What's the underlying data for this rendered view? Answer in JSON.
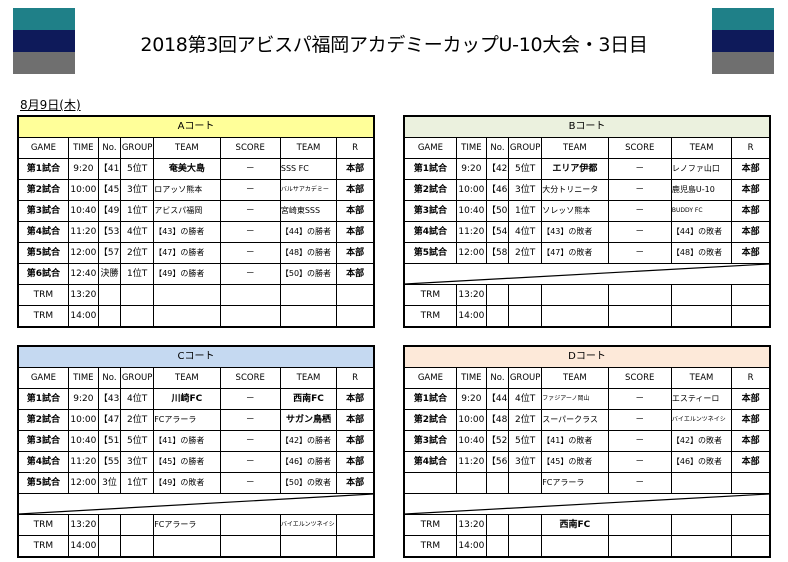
{
  "title": "2018第3回アビスパ福岡アカデミーカップU-10大会・3日目",
  "date": "8月9日(木)",
  "flag_colors": [
    "#1f8088",
    "#0e1a5a",
    "#6f6f6f"
  ],
  "columns": [
    "GAME",
    "TIME",
    "No.",
    "GROUP",
    "TEAM",
    "SCORE",
    "TEAM",
    "R"
  ],
  "courts": [
    {
      "name": "Aコート",
      "color": "#ffff99",
      "rows": [
        [
          "第1試合",
          "9:20",
          "【41】",
          "5位T",
          "奄美大島",
          "－",
          "SSS FC",
          "本部"
        ],
        [
          "第2試合",
          "10:00",
          "【45】",
          "3位T",
          "ロアッソ熊本",
          "－",
          "バルサアカデミー",
          "本部"
        ],
        [
          "第3試合",
          "10:40",
          "【49】",
          "1位T",
          "アビスパ福岡",
          "－",
          "宮崎東SSS",
          "本部"
        ],
        [
          "第4試合",
          "11:20",
          "【53】",
          "4位T",
          "【43】の勝者",
          "－",
          "【44】の勝者",
          "本部"
        ],
        [
          "第5試合",
          "12:00",
          "【57】",
          "2位T",
          "【47】の勝者",
          "－",
          "【48】の勝者",
          "本部"
        ],
        [
          "第6試合",
          "12:40",
          "決勝",
          "1位T",
          "【49】の勝者",
          "－",
          "【50】の勝者",
          "本部"
        ]
      ],
      "trm": [
        [
          "TRM",
          "13:20",
          "",
          "",
          "",
          "",
          "",
          ""
        ],
        [
          "TRM",
          "14:00",
          "",
          "",
          "",
          "",
          "",
          ""
        ]
      ],
      "has_divider": false
    },
    {
      "name": "Bコート",
      "color": "#ebf1de",
      "rows": [
        [
          "第1試合",
          "9:20",
          "【42】",
          "5位T",
          "エリア伊都",
          "－",
          "レノファ山口",
          "本部"
        ],
        [
          "第2試合",
          "10:00",
          "【46】",
          "3位T",
          "大分トリニータ",
          "－",
          "鹿児島U-10",
          "本部"
        ],
        [
          "第3試合",
          "10:40",
          "【50】",
          "1位T",
          "ソレッソ熊本",
          "－",
          "BUDDY FC",
          "本部"
        ],
        [
          "第4試合",
          "11:20",
          "【54】",
          "4位T",
          "【43】の敗者",
          "－",
          "【44】の敗者",
          "本部"
        ],
        [
          "第5試合",
          "12:00",
          "【58】",
          "2位T",
          "【47】の敗者",
          "－",
          "【48】の敗者",
          "本部"
        ]
      ],
      "trm": [
        [
          "TRM",
          "13:20",
          "",
          "",
          "",
          "",
          "",
          ""
        ],
        [
          "TRM",
          "14:00",
          "",
          "",
          "",
          "",
          "",
          ""
        ]
      ],
      "has_divider": true
    },
    {
      "name": "Cコート",
      "color": "#c5d9f1",
      "rows": [
        [
          "第1試合",
          "9:20",
          "【43】",
          "4位T",
          "川崎FC",
          "－",
          "西南FC",
          "本部"
        ],
        [
          "第2試合",
          "10:00",
          "【47】",
          "2位T",
          "FCアラーラ",
          "－",
          "サガン鳥栖",
          "本部"
        ],
        [
          "第3試合",
          "10:40",
          "【51】",
          "5位T",
          "【41】の勝者",
          "－",
          "【42】の勝者",
          "本部"
        ],
        [
          "第4試合",
          "11:20",
          "【55】",
          "3位T",
          "【45】の勝者",
          "－",
          "【46】の勝者",
          "本部"
        ],
        [
          "第5試合",
          "12:00",
          "3位",
          "1位T",
          "【49】の敗者",
          "－",
          "【50】の敗者",
          "本部"
        ]
      ],
      "trm": [
        [
          "TRM",
          "13:20",
          "",
          "",
          "FCアラーラ",
          "",
          "バイエルンツネイシ",
          ""
        ],
        [
          "TRM",
          "14:00",
          "",
          "",
          "",
          "",
          "",
          ""
        ]
      ],
      "has_divider": true
    },
    {
      "name": "Dコート",
      "color": "#fde9d9",
      "rows": [
        [
          "第1試合",
          "9:20",
          "【44】",
          "4位T",
          "ファジアーノ岡山",
          "－",
          "エスティーロ",
          "本部"
        ],
        [
          "第2試合",
          "10:00",
          "【48】",
          "2位T",
          "スーパークラス",
          "－",
          "バイエルンツネイシ",
          "本部"
        ],
        [
          "第3試合",
          "10:40",
          "【52】",
          "5位T",
          "【41】の敗者",
          "－",
          "【42】の敗者",
          "本部"
        ],
        [
          "第4試合",
          "11:20",
          "【56】",
          "3位T",
          "【45】の敗者",
          "－",
          "【46】の敗者",
          "本部"
        ],
        [
          "",
          "",
          "",
          "",
          "FCアラーラ",
          "－",
          "",
          ""
        ]
      ],
      "trm": [
        [
          "TRM",
          "13:20",
          "",
          "",
          "西南FC",
          "",
          "",
          ""
        ],
        [
          "TRM",
          "14:00",
          "",
          "",
          "",
          "",
          "",
          ""
        ]
      ],
      "has_divider": true
    }
  ]
}
